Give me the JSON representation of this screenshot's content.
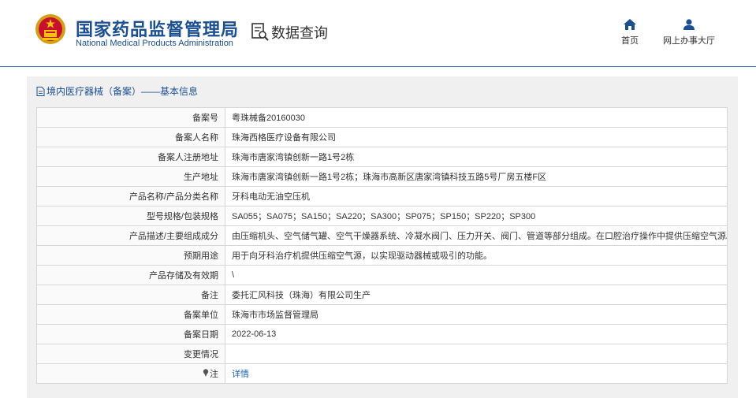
{
  "header": {
    "org_cn": "国家药品监督管理局",
    "org_en": "National Medical Products Administration",
    "query_label": "数据查询",
    "nav": [
      {
        "label": "首页",
        "icon": "home-icon"
      },
      {
        "label": "网上办事大厅",
        "icon": "user-icon"
      }
    ]
  },
  "panel": {
    "title": "境内医疗器械（备案）——基本信息"
  },
  "rows": [
    {
      "label": "备案号",
      "value": "粤珠械备20160030"
    },
    {
      "label": "备案人名称",
      "value": "珠海西格医疗设备有限公司"
    },
    {
      "label": "备案人注册地址",
      "value": "珠海市唐家湾镇创新一路1号2栋"
    },
    {
      "label": "生产地址",
      "value": "珠海市唐家湾镇创新一路1号2栋；珠海市高新区唐家湾镇科技五路5号厂房五楼F区"
    },
    {
      "label": "产品名称/产品分类名称",
      "value": "牙科电动无油空压机"
    },
    {
      "label": "型号规格/包装规格",
      "value": "SA055；SA075；SA150；SA220；SA300；SP075；SP150；SP220；SP300"
    },
    {
      "label": "产品描述/主要组成成分",
      "value": "由压缩机头、空气储气罐、空气干燥器系统、冷凝水阀门、压力开关、阀门、管道等部分组成。在口腔治疗操作中提供压缩空气源。"
    },
    {
      "label": "预期用途",
      "value": "用于向牙科治疗机提供压缩空气源，以实现驱动器械或吸引的功能。"
    },
    {
      "label": "产品存储及有效期",
      "value": "\\"
    },
    {
      "label": "备注",
      "value": "委托汇风科技（珠海）有限公司生产"
    },
    {
      "label": "备案单位",
      "value": "珠海市市场监督管理局"
    },
    {
      "label": "备案日期",
      "value": "2022-06-13"
    },
    {
      "label": "变更情况",
      "value": ""
    }
  ],
  "note_row": {
    "label": "注",
    "link": "详情"
  },
  "colors": {
    "brand": "#1b4f93",
    "link": "#1b63b8",
    "border": "#d6d6d6",
    "panel_bg": "#f0f0f0"
  }
}
